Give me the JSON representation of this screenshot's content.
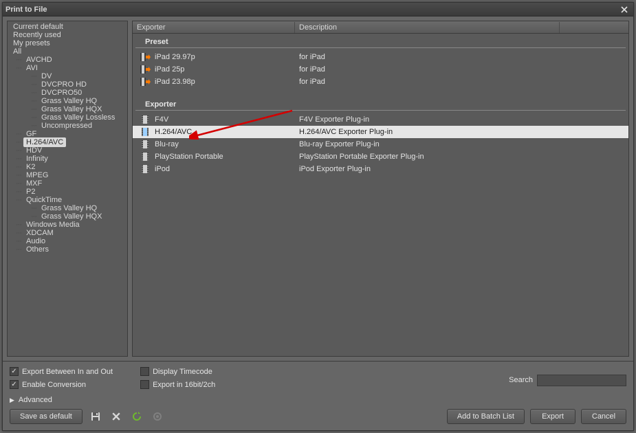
{
  "title": "Print to File",
  "tree": {
    "top": [
      "Current default",
      "Recently used",
      "My presets",
      "All"
    ],
    "all_children": [
      {
        "label": "AVCHD"
      },
      {
        "label": "AVI",
        "children": [
          "DV",
          "DVCPRO HD",
          "DVCPRO50",
          "Grass Valley HQ",
          "Grass Valley HQX",
          "Grass Valley Lossless",
          "Uncompressed"
        ]
      },
      {
        "label": "GF"
      },
      {
        "label": "H.264/AVC",
        "selected": true
      },
      {
        "label": "HDV"
      },
      {
        "label": "Infinity"
      },
      {
        "label": "K2"
      },
      {
        "label": "MPEG"
      },
      {
        "label": "MXF"
      },
      {
        "label": "P2"
      },
      {
        "label": "QuickTime",
        "children": [
          "Grass Valley HQ",
          "Grass Valley HQX"
        ]
      },
      {
        "label": "Windows Media"
      },
      {
        "label": "XDCAM"
      },
      {
        "label": "Audio"
      },
      {
        "label": "Others"
      }
    ]
  },
  "columns": {
    "exporter": "Exporter",
    "description": "Description"
  },
  "groups": {
    "preset": "Preset",
    "exporter": "Exporter"
  },
  "presets": [
    {
      "name": "iPad 29.97p",
      "desc": "for iPad"
    },
    {
      "name": "iPad 25p",
      "desc": "for iPad"
    },
    {
      "name": "iPad 23.98p",
      "desc": "for iPad"
    }
  ],
  "exporters": [
    {
      "name": "F4V",
      "desc": "F4V Exporter Plug-in"
    },
    {
      "name": "H.264/AVC",
      "desc": "H.264/AVC Exporter Plug-in",
      "selected": true
    },
    {
      "name": "Blu-ray",
      "desc": "Blu-ray Exporter Plug-in"
    },
    {
      "name": "PlayStation Portable",
      "desc": "PlayStation Portable Exporter Plug-in"
    },
    {
      "name": "iPod",
      "desc": "iPod Exporter Plug-in"
    }
  ],
  "checks": {
    "export_in_out": "Export Between In and Out",
    "enable_conv": "Enable Conversion",
    "disp_tc": "Display Timecode",
    "export_16": "Export in 16bit/2ch"
  },
  "advanced": "Advanced",
  "search_label": "Search",
  "buttons": {
    "save_default": "Save as default",
    "add_batch": "Add to Batch List",
    "export": "Export",
    "cancel": "Cancel"
  }
}
